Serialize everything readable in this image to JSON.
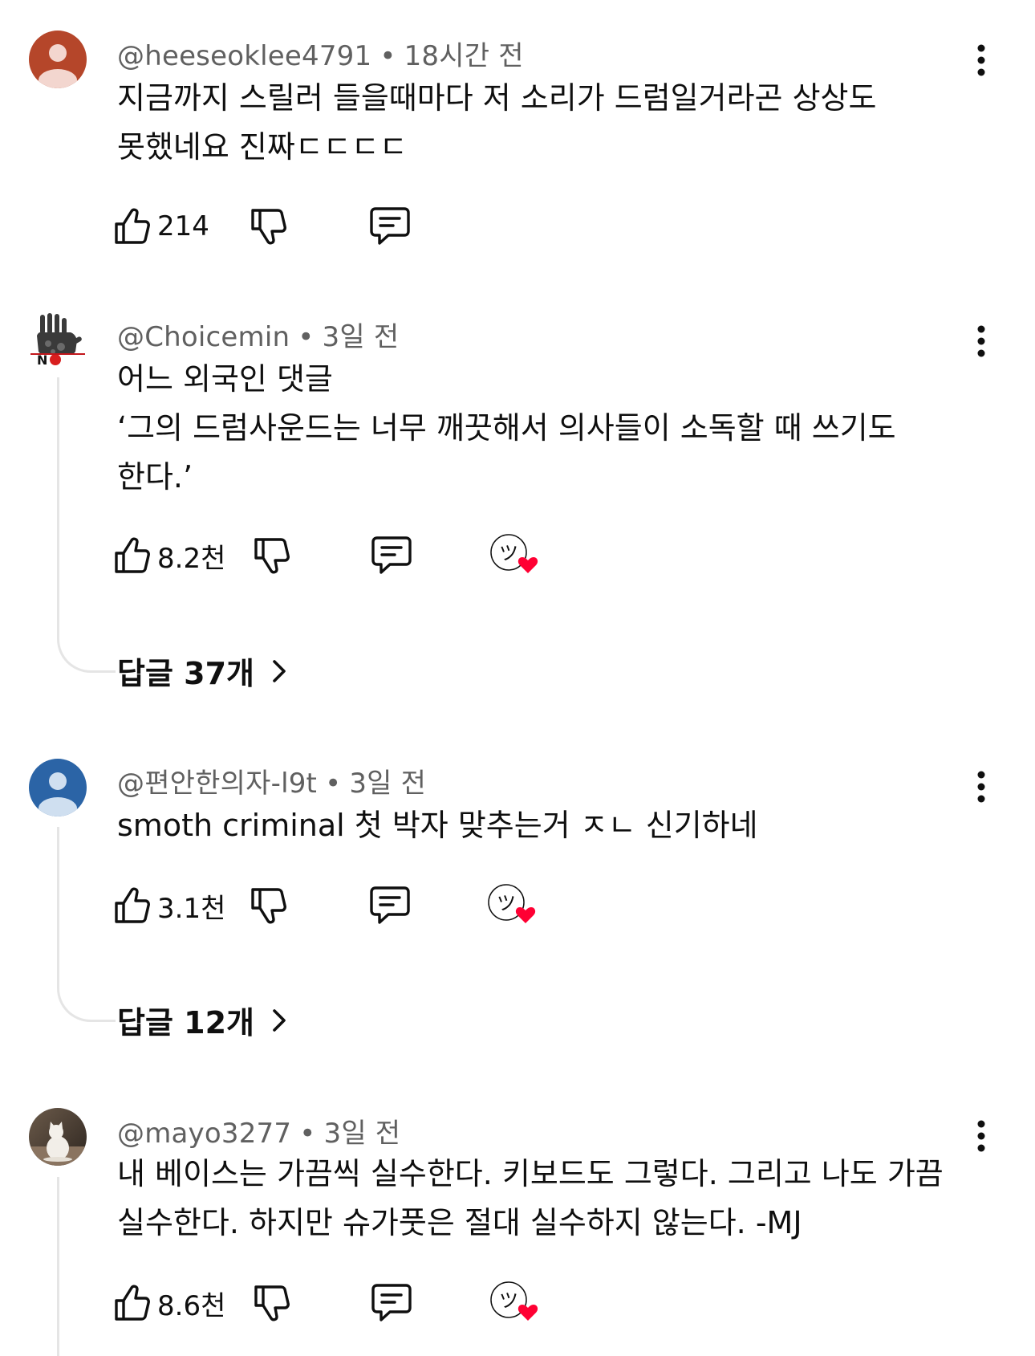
{
  "comments": [
    {
      "author": "@heeseoklee4791",
      "time": "18시간 전",
      "text": "지금까지 스릴러 들을때마다 저 소리가 드럼일거라곤 상상도 못했네요 진짜ㄷㄷㄷㄷ",
      "likes": "214",
      "avatar": "default-person-icon",
      "avatar_color": "#b5462a"
    },
    {
      "author": "@Choicemin",
      "time": "3일 전",
      "text": "어느 외국인 댓글\n‘그의 드럼사운드는 너무 깨끗해서 의사들이 소독할 때 쓰기도 한다.’",
      "likes": "8.2천",
      "avatar": "handprint-image",
      "replies": "답글 37개"
    },
    {
      "author": "@편안한의자-l9t",
      "time": "3일 전",
      "text": "smoth criminal 첫 박자 맞추는거 ㅈㄴ 신기하네",
      "likes": "3.1천",
      "avatar": "default-person-icon",
      "avatar_color": "#2b64a6",
      "replies": "답글 12개"
    },
    {
      "author": "@mayo3277",
      "time": "3일 전",
      "text": "내 베이스는 가끔씩 실수한다. 키보드도 그렇다. 그리고 나도 가끔 실수한다. 하지만 슈가풋은 절대 실수하지 않는다. -MJ",
      "likes": "8.6천",
      "avatar": "cat-photo"
    }
  ],
  "ui": {
    "dot": "•",
    "creator_heart_glyph": "ツ"
  },
  "icons": [
    "like-icon",
    "dislike-icon",
    "reply-icon",
    "creator-heart-icon",
    "more-options-icon",
    "chevron-right-icon"
  ]
}
